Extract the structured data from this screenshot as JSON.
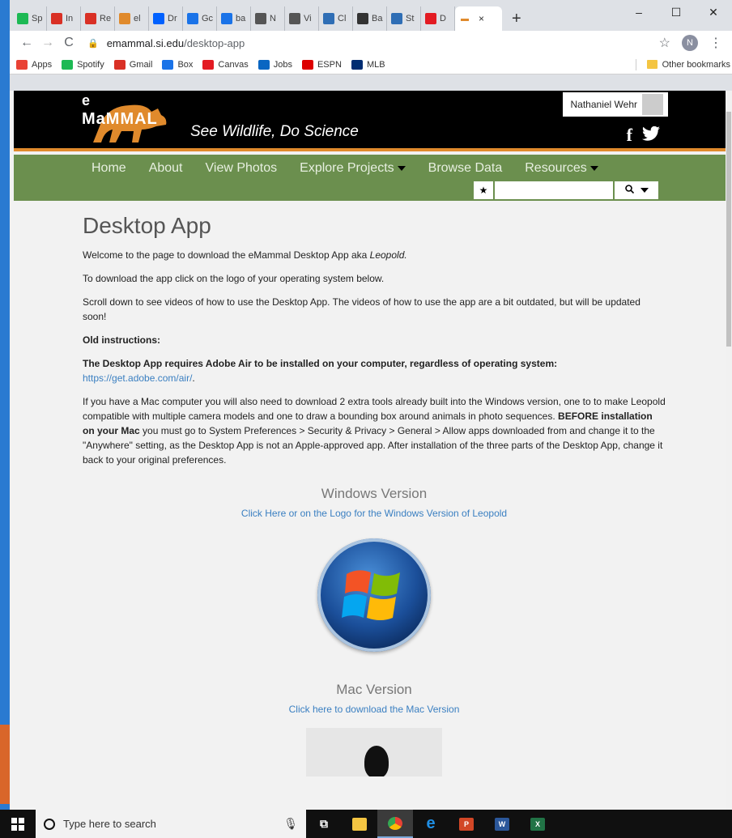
{
  "browser": {
    "tabs": [
      {
        "label": "Sp",
        "favicon": "spotify-icon",
        "color": "#1db954"
      },
      {
        "label": "In",
        "favicon": "gmail-icon",
        "color": "#d93025"
      },
      {
        "label": "Re",
        "favicon": "gmail-icon",
        "color": "#d93025"
      },
      {
        "label": "el",
        "favicon": "emammal-icon",
        "color": "#e08a2c"
      },
      {
        "label": "Dr",
        "favicon": "dropbox-icon",
        "color": "#0061ff"
      },
      {
        "label": "Gc",
        "favicon": "calendar-icon",
        "color": "#1a73e8"
      },
      {
        "label": "ba",
        "favicon": "box-icon",
        "color": "#1a73e8"
      },
      {
        "label": "N",
        "favicon": "bug-icon",
        "color": "#555555"
      },
      {
        "label": "Vi",
        "favicon": "bug-icon",
        "color": "#555555"
      },
      {
        "label": "Cl",
        "favicon": "aps-icon",
        "color": "#2f6eb5"
      },
      {
        "label": "Ba",
        "favicon": "globe-icon",
        "color": "#333333"
      },
      {
        "label": "St",
        "favicon": "s-icon",
        "color": "#2f6eb5"
      },
      {
        "label": "D",
        "favicon": "canvas-icon",
        "color": "#e31b23"
      }
    ],
    "active_tab_favicon": "emammal-icon",
    "active_tab_close": "×",
    "new_tab": "+",
    "window_controls": {
      "minimize": "–",
      "maximize": "☐",
      "close": "✕"
    },
    "nav": {
      "back": "←",
      "forward": "→",
      "reload": "C"
    },
    "url_domain": "emammal.si.edu",
    "url_path": "/desktop-app",
    "profile_initial": "N",
    "bookmarks": [
      {
        "label": "Apps",
        "icon": "apps-grid-icon",
        "color": "#e94235"
      },
      {
        "label": "Spotify",
        "icon": "spotify-icon",
        "color": "#1db954"
      },
      {
        "label": "Gmail",
        "icon": "gmail-icon",
        "color": "#d93025"
      },
      {
        "label": "Box",
        "icon": "box-icon",
        "color": "#1a73e8"
      },
      {
        "label": "Canvas",
        "icon": "canvas-icon",
        "color": "#e31b23"
      },
      {
        "label": "Jobs",
        "icon": "jobs-icon",
        "color": "#0a66c2"
      },
      {
        "label": "ESPN",
        "icon": "espn-icon",
        "color": "#d00"
      },
      {
        "label": "MLB",
        "icon": "mlb-icon",
        "color": "#002d72"
      }
    ],
    "other_bookmarks": "Other bookmarks"
  },
  "site": {
    "logo_e": "e",
    "logo_word": "MaMMAL",
    "tagline": "See Wildlife, Do Science",
    "user_name": "Nathaniel Wehr",
    "facebook": "f",
    "twitter": "🐦",
    "nav": [
      {
        "label": "Home",
        "dropdown": false
      },
      {
        "label": "About",
        "dropdown": false
      },
      {
        "label": "View Photos",
        "dropdown": false
      },
      {
        "label": "Explore Projects",
        "dropdown": true
      },
      {
        "label": "Browse Data",
        "dropdown": false
      },
      {
        "label": "Resources",
        "dropdown": true
      }
    ],
    "search_value": "",
    "favorite_star": "★",
    "search_icon": "🔍"
  },
  "content": {
    "title": "Desktop App",
    "intro_prefix": "Welcome to the page to download the eMammal Desktop App aka ",
    "intro_em": "Leopold.",
    "p2": "To download the app click on the logo of your operating system below.",
    "p3": "Scroll down to see videos of how to use the Desktop App. The videos of how to use the app are a bit outdated, but will be updated soon!",
    "old_instructions": "Old instructions:",
    "adobe_bold": "The Desktop App requires Adobe Air to be installed on your computer, regardless of operating system:",
    "adobe_link": "https://get.adobe.com/air/",
    "adobe_after": ".",
    "mac_p_1": "If you have a Mac computer you will also need to download 2 extra tools already built into the Windows version, one to to make Leopold compatible with multiple camera models and one to draw a bounding box around animals in photo sequences. ",
    "mac_p_bold": "BEFORE installation on your Mac",
    "mac_p_2": " you must go to System Preferences > Security & Privacy > General > Allow apps downloaded from and change it to the \"Anywhere\" setting, as the Desktop App is not an Apple-approved app. After installation of the three parts of the Desktop App, change it back to your original preferences.",
    "windows_title": "Windows Version",
    "windows_link": "Click Here or on the Logo for the Windows Version of Leopold",
    "mac_title": "Mac Version",
    "mac_link": "Click here to download the Mac Version"
  },
  "taskbar": {
    "search_placeholder": "Type here to search",
    "apps": [
      {
        "name": "task-view-icon",
        "label": "⧉",
        "color": "#ffffff"
      },
      {
        "name": "file-explorer-icon",
        "label": "",
        "color": "#f4c542"
      },
      {
        "name": "chrome-icon",
        "label": "",
        "color": "#e94235"
      },
      {
        "name": "edge-icon",
        "label": "e",
        "color": "#1f8fe5"
      },
      {
        "name": "powerpoint-icon",
        "label": "P",
        "color": "#d24726"
      },
      {
        "name": "word-icon",
        "label": "W",
        "color": "#2b579a"
      },
      {
        "name": "excel-icon",
        "label": "X",
        "color": "#217346"
      }
    ]
  }
}
